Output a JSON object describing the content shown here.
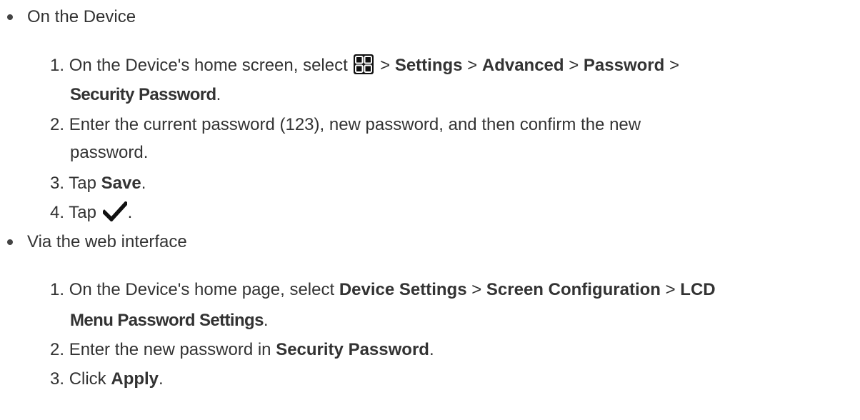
{
  "sections": [
    {
      "title": "On the Device",
      "steps": [
        {
          "num": "1.",
          "line1": {
            "t1": "On the Device's home screen, select ",
            "icon": "apps-grid-icon",
            "t2": " > ",
            "b1": "Settings",
            "t3": " > ",
            "b2": "Advanced",
            "t4": " > ",
            "b3": "Password",
            "t5": " >"
          },
          "line2": {
            "b1": "Security Password",
            "t1": "."
          }
        },
        {
          "num": "2.",
          "line1": "Enter the current password (123), new password, and then confirm the new",
          "line2": "password."
        },
        {
          "num": "3.",
          "t1": "Tap ",
          "b1": "Save",
          "t2": "."
        },
        {
          "num": "4.",
          "t1": "Tap ",
          "icon": "checkmark-icon",
          "t2": "."
        }
      ]
    },
    {
      "title": "Via the web interface",
      "steps": [
        {
          "num": "1.",
          "line1": {
            "t1": "On the Device's home page, select ",
            "b1": "Device Settings",
            "t2": " > ",
            "b2": "Screen Configuration",
            "t3": " > ",
            "b3": "LCD"
          },
          "line2": {
            "b1": "Menu Password Settings",
            "t1": "."
          }
        },
        {
          "num": "2.",
          "t1": "Enter the new password in ",
          "b1": "Security Password",
          "t2": "."
        },
        {
          "num": "3.",
          "t1": "Click ",
          "b1": "Apply",
          "t2": "."
        }
      ]
    }
  ]
}
